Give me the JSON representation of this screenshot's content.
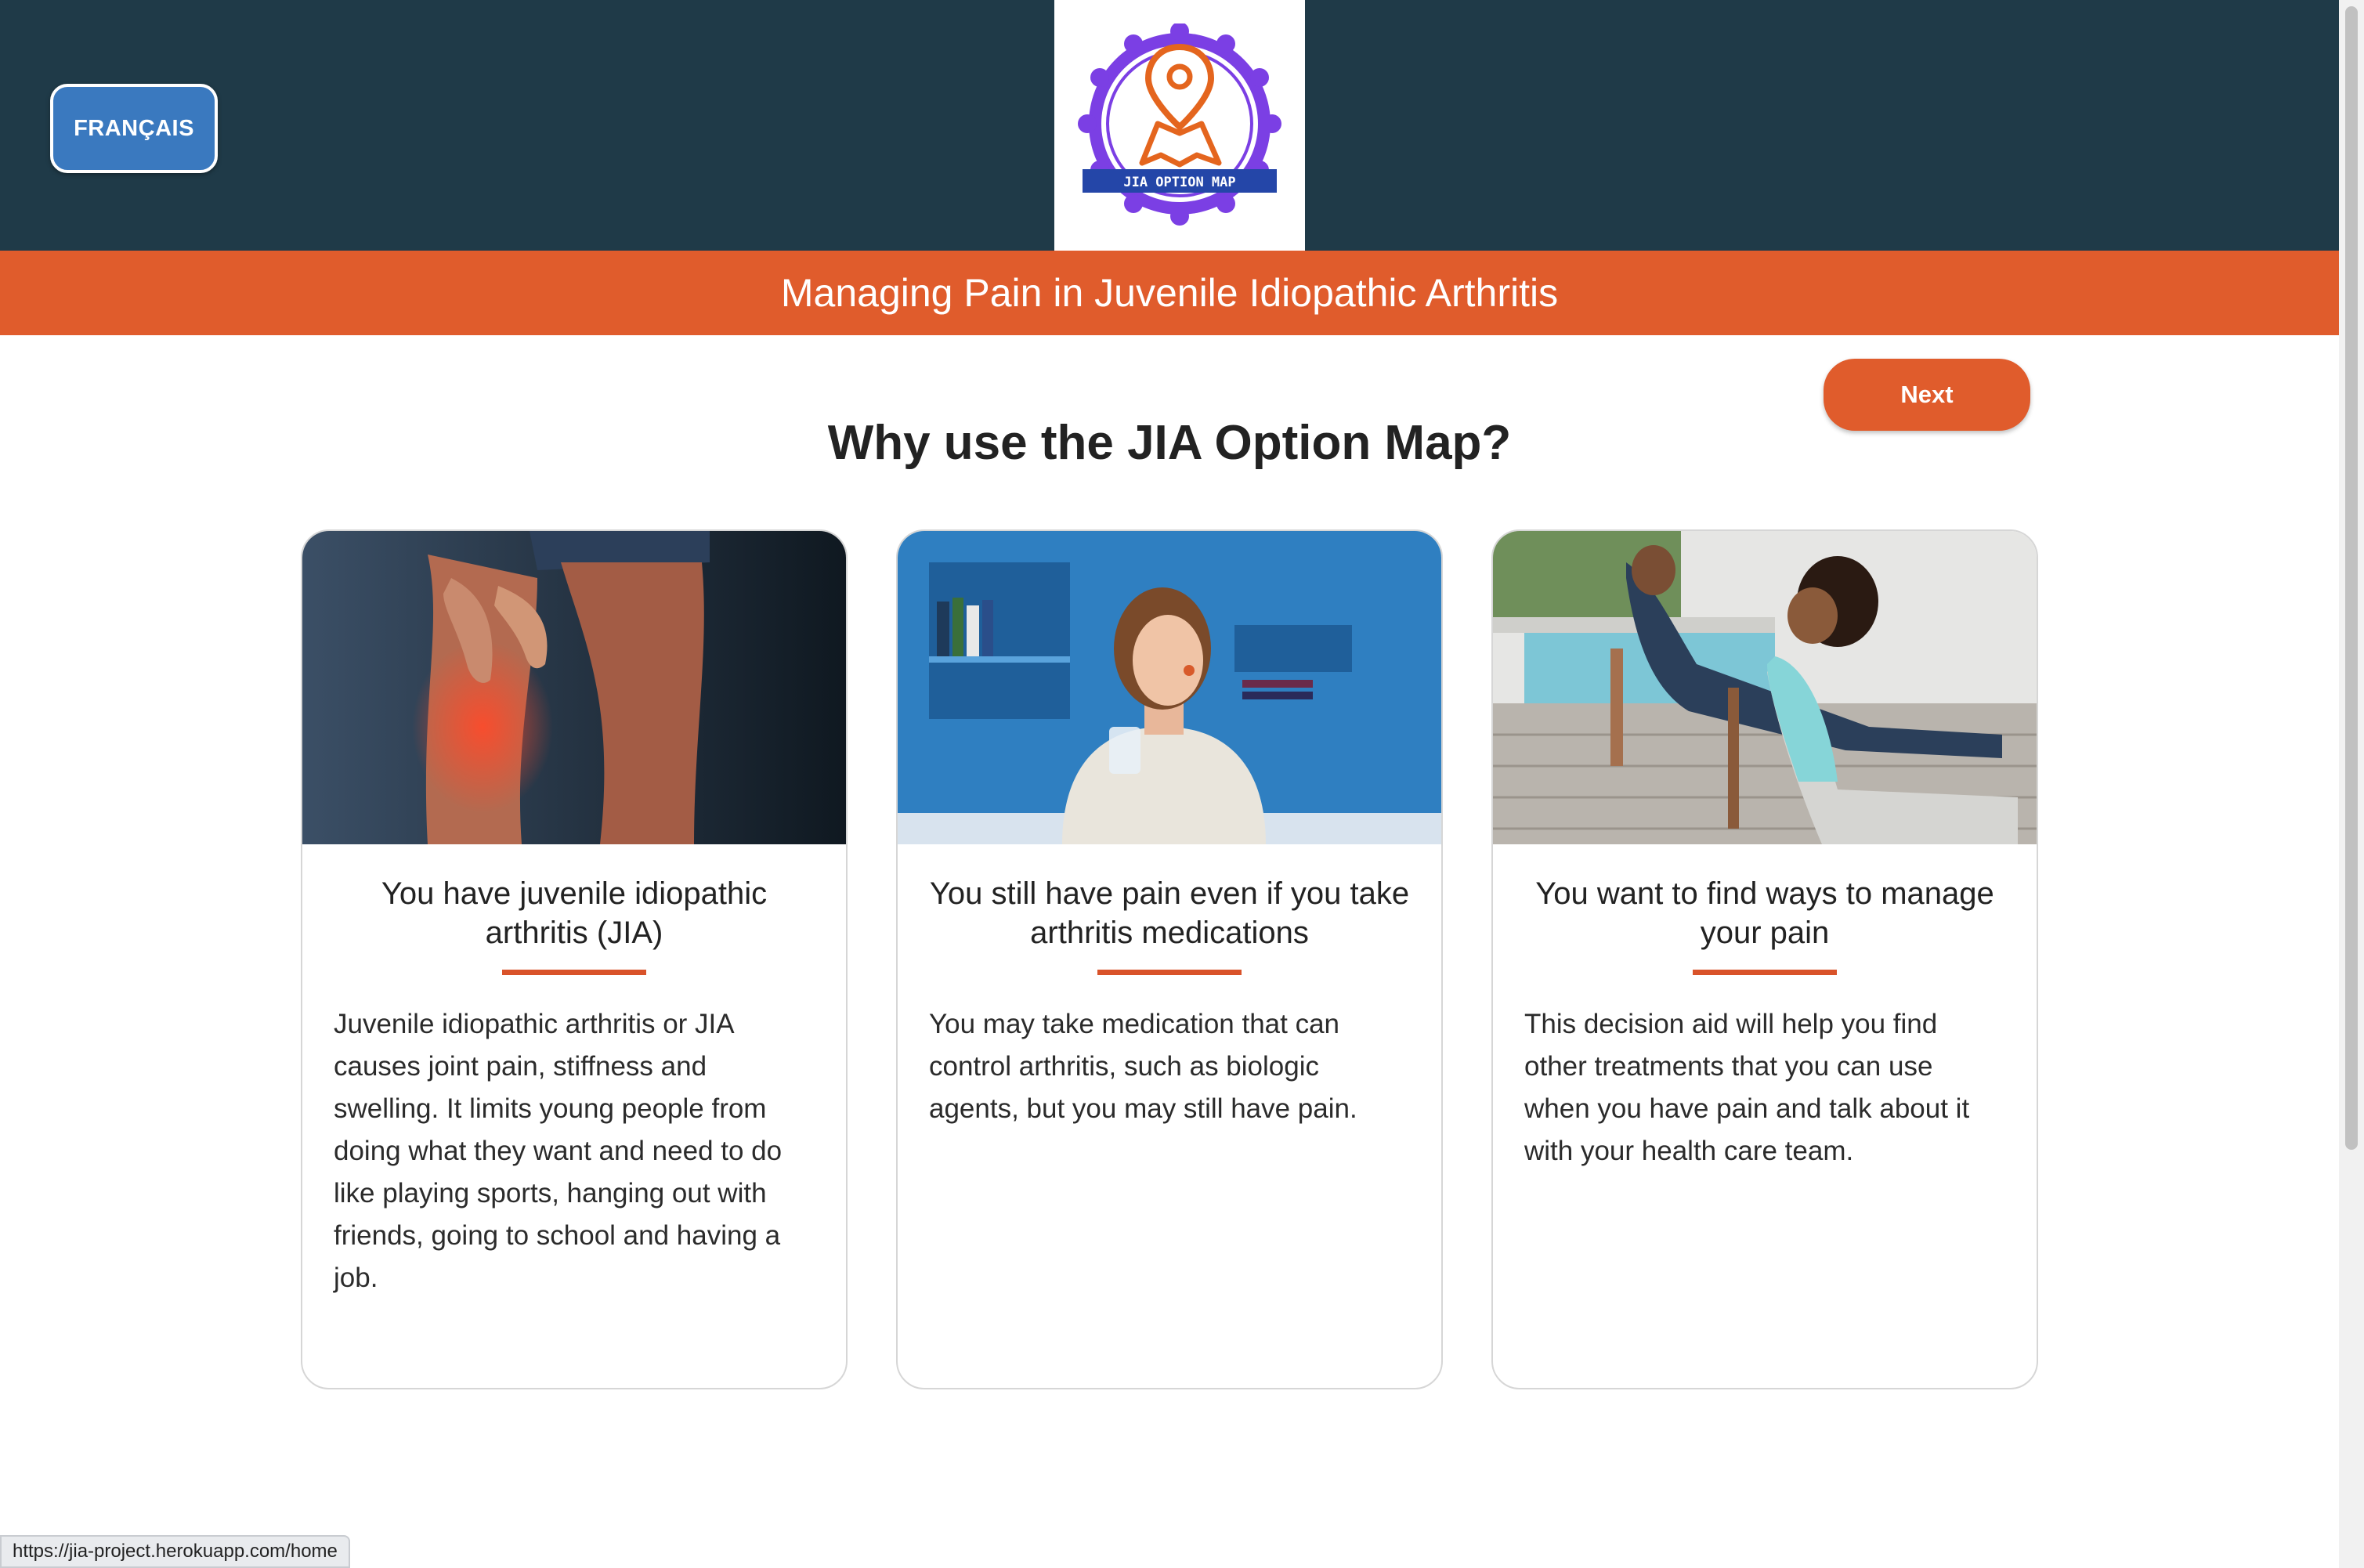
{
  "header": {
    "language_button": "FRANÇAIS",
    "logo_text": "JIA OPTION MAP",
    "banner_title": "Managing Pain in Juvenile Idiopathic Arthritis"
  },
  "nav": {
    "next_label": "Next"
  },
  "main": {
    "heading": "Why use the JIA Option Map?",
    "cards": [
      {
        "image": "knee-pain-photo",
        "title": "You have juvenile idiopathic arthritis (JIA)",
        "text": "Juvenile idiopathic arthritis or JIA causes joint pain, stiffness and swelling. It limits young people from doing what they want and need to do like playing sports, hanging out with friends, going to school and having a job."
      },
      {
        "image": "girl-taking-pill-photo",
        "title": "You still have pain even if you take arthritis medications",
        "text": "You may take medication that can control arthritis, such as biologic agents, but you may still have pain."
      },
      {
        "image": "yoga-outdoors-photo",
        "title": "You want to find ways to manage your pain",
        "text": "This decision aid will help you find other treatments that you can use when you have pain and talk about it with your health care team."
      }
    ]
  },
  "status_bar": {
    "url": "https://jia-project.herokuapp.com/home"
  },
  "colors": {
    "header_bg": "#1f3a48",
    "banner_bg": "#e05c2c",
    "accent": "#d9532a",
    "language_button_bg": "#3a79bf",
    "logo_purple": "#7b3fe4",
    "logo_orange": "#e4651e"
  }
}
